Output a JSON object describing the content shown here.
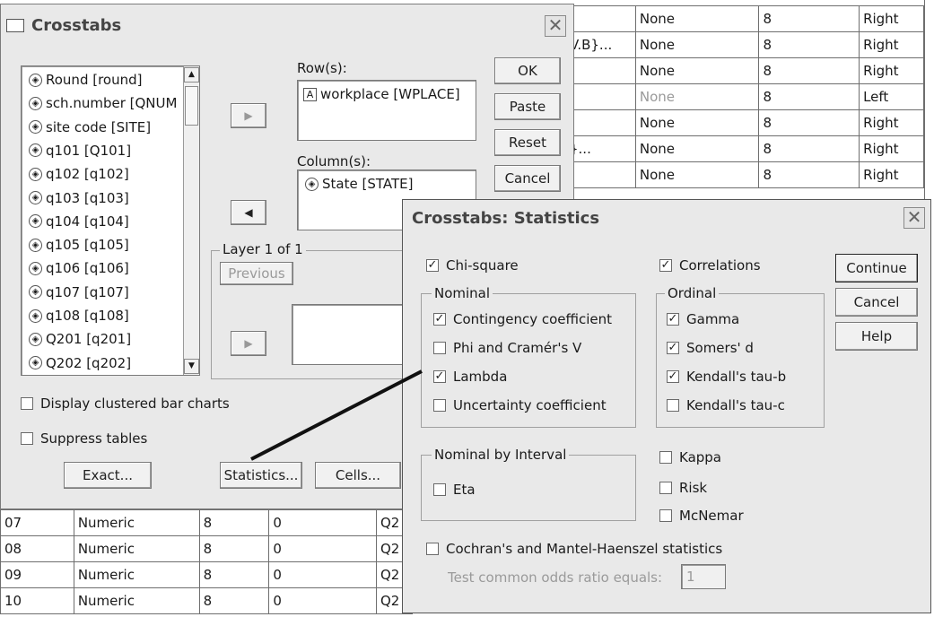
{
  "bg_grid_top": {
    "rows": [
      [
        "",
        "None",
        "8",
        "Right"
      ],
      [
        "V.B}...",
        "None",
        "8",
        "Right"
      ],
      [
        "",
        "None",
        "8",
        "Right"
      ],
      [
        "",
        "None",
        "8",
        "Left"
      ],
      [
        "",
        "None",
        "8",
        "Right"
      ],
      [
        "}...",
        "None",
        "8",
        "Right"
      ],
      [
        "",
        "None",
        "8",
        "Right"
      ]
    ]
  },
  "bg_grid_bottom": {
    "rows": [
      [
        "07",
        "Numeric",
        "8",
        "0",
        "Q2"
      ],
      [
        "08",
        "Numeric",
        "8",
        "0",
        "Q2"
      ],
      [
        "09",
        "Numeric",
        "8",
        "0",
        "Q2"
      ],
      [
        "10",
        "Numeric",
        "8",
        "0",
        "Q2"
      ]
    ]
  },
  "crosstabs": {
    "title": "Crosstabs",
    "close_glyph": "✕",
    "variables": [
      "Round [round]",
      "sch.number [QNUM",
      "site code [SITE]",
      "q101 [Q101]",
      "q102 [q102]",
      "q103 [q103]",
      "q104 [q104]",
      "q105 [q105]",
      "q106 [q106]",
      "q107 [q107]",
      "q108 [q108]",
      "Q201 [q201]",
      "Q202 [q202]"
    ],
    "rows_label": "Row(s):",
    "row_item": "workplace [WPLACE]",
    "columns_label": "Column(s):",
    "column_item": "State [STATE]",
    "layer_label": "Layer 1 of 1",
    "previous": "Previous",
    "ok": "OK",
    "paste": "Paste",
    "reset": "Reset",
    "cancel": "Cancel",
    "display_clustered": "Display clustered bar charts",
    "suppress_tables": "Suppress tables",
    "exact": "Exact...",
    "statistics": "Statistics...",
    "cells": "Cells..."
  },
  "stats": {
    "title": "Crosstabs: Statistics",
    "close_glyph": "✕",
    "chi_square": "Chi-square",
    "correlations": "Correlations",
    "nominal_label": "Nominal",
    "contingency": "Contingency coefficient",
    "phi": "Phi and Cramér's V",
    "lambda": "Lambda",
    "uncertainty": "Uncertainty coefficient",
    "ordinal_label": "Ordinal",
    "gamma": "Gamma",
    "somers": "Somers' d",
    "tau_b": "Kendall's tau-b",
    "tau_c": "Kendall's tau-c",
    "nbi_label": "Nominal by Interval",
    "eta": "Eta",
    "kappa": "Kappa",
    "risk": "Risk",
    "mcnemar": "McNemar",
    "cochran": "Cochran's and Mantel-Haenszel statistics",
    "odds_label": "Test common odds ratio equals:",
    "odds_value": "1",
    "continue": "Continue",
    "cancel": "Cancel",
    "help": "Help",
    "check_mark": "✓"
  },
  "colors": {
    "dialog_bg": "#e9e9e9",
    "disabled_text": "#9a9a9a",
    "pointer_line": "#111111"
  }
}
